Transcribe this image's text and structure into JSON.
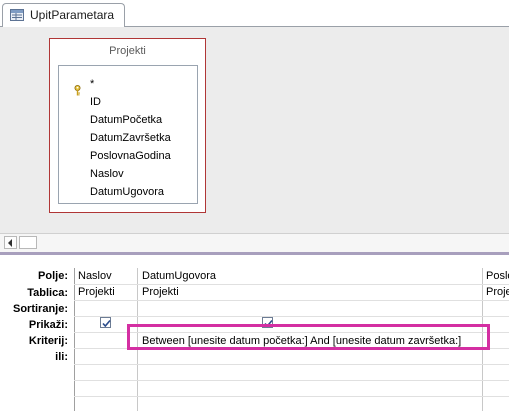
{
  "tab": {
    "label": "UpitParametara"
  },
  "table": {
    "title": "Projekti",
    "fields": [
      "*",
      "ID",
      "DatumPočetka",
      "DatumZavršetka",
      "PoslovnaGodina",
      "Naslov",
      "DatumUgovora"
    ]
  },
  "grid": {
    "row_labels": [
      "Polje:",
      "Tablica:",
      "Sortiranje:",
      "Prikaži:",
      "Kriterij:",
      "ili:"
    ],
    "columns": [
      {
        "field": "Naslov",
        "table": "Projekti",
        "show": true,
        "criteria": ""
      },
      {
        "field": "DatumUgovora",
        "table": "Projekti",
        "show": true,
        "criteria": "Between [unesite datum početka:] And [unesite datum završetka:]"
      },
      {
        "field": "Poslo",
        "table": "Proje",
        "show": false,
        "criteria": ""
      }
    ]
  },
  "colors": {
    "highlight": "#d42fa2",
    "table_border": "#b03636",
    "splitter": "#a89fbd"
  }
}
